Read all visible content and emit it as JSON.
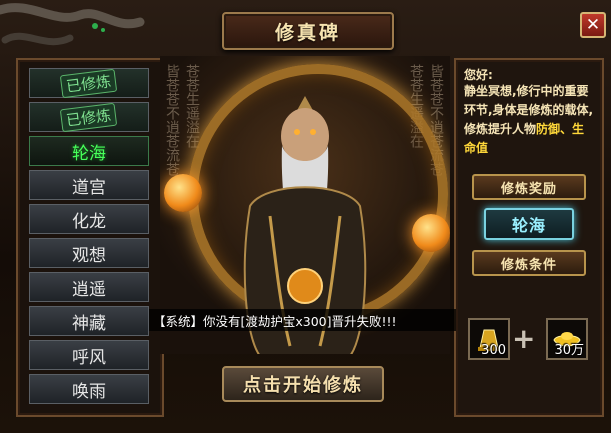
{
  "window": {
    "title": "修真碑",
    "close_glyph": "✕"
  },
  "realms": [
    {
      "label": "已修炼",
      "state": "done"
    },
    {
      "label": "已修炼",
      "state": "done"
    },
    {
      "label": "轮海",
      "state": "active"
    },
    {
      "label": "道宫",
      "state": "locked"
    },
    {
      "label": "化龙",
      "state": "locked"
    },
    {
      "label": "观想",
      "state": "locked"
    },
    {
      "label": "逍遥",
      "state": "locked"
    },
    {
      "label": "神藏",
      "state": "locked"
    },
    {
      "label": "呼风",
      "state": "locked"
    },
    {
      "label": "唤雨",
      "state": "locked"
    }
  ],
  "info": {
    "greeting": "您好:",
    "desc_part1": "静坐冥想,修行中的重要环节,身体是修炼的载体,修炼提升",
    "desc_part2": "人物",
    "highlight": "防御、生命值"
  },
  "buttons": {
    "reward": "修炼奖励",
    "current_realm": "轮海",
    "conditions": "修炼条件",
    "start": "点击开始修炼"
  },
  "cost": {
    "item1_count": "300",
    "plus": "+",
    "item2_count": "30万"
  },
  "notice": "【系统】你没有[渡劫护宝x300]晋升失败!!!",
  "colors": {
    "active_realm": "#47ff5a",
    "highlight": "#ffd83a",
    "current_button_glow": "#4ac0d8"
  },
  "icons": {
    "item1": "bell-ingot-icon",
    "item2": "gold-ingot-icon"
  }
}
